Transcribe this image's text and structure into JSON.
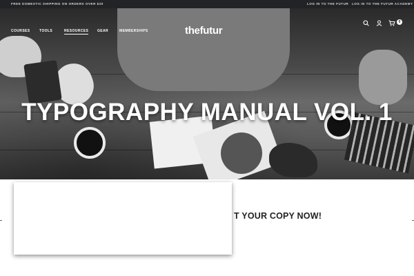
{
  "announcement": {
    "shipping": "FREE DOMESTIC SHIPPING ON ORDERS OVER $20",
    "login_futur": "LOG IN TO THE FUTUR",
    "login_academy": "LOG IN TO THE FUTUR ACADEMY"
  },
  "nav": {
    "items": [
      "COURSES",
      "TOOLS",
      "RESOURCES",
      "GEAR",
      "MEMBERSHIPS"
    ],
    "active_index": 2,
    "logo": "thefutur",
    "cart_count": "0"
  },
  "hero": {
    "title": "TYPOGRAPHY MANUAL VOL. 1"
  },
  "cta": {
    "text": "T YOUR COPY NOW!"
  },
  "colors": {
    "topbar_bg": "#222326",
    "accent_text": "#ffffff"
  }
}
